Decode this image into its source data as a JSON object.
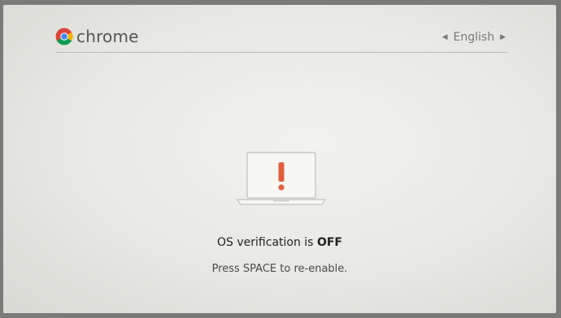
{
  "header": {
    "brand": "chrome",
    "language": "English"
  },
  "message": {
    "title_prefix": "OS verification is ",
    "title_status": "OFF",
    "instruction": "Press SPACE to re-enable."
  },
  "colors": {
    "warning_accent": "#e0623a",
    "background": "#ecece8"
  },
  "icons": {
    "logo": "chrome-logo-icon",
    "warning": "laptop-warning-icon",
    "prev_language": "arrow-left-icon",
    "next_language": "arrow-right-icon"
  }
}
